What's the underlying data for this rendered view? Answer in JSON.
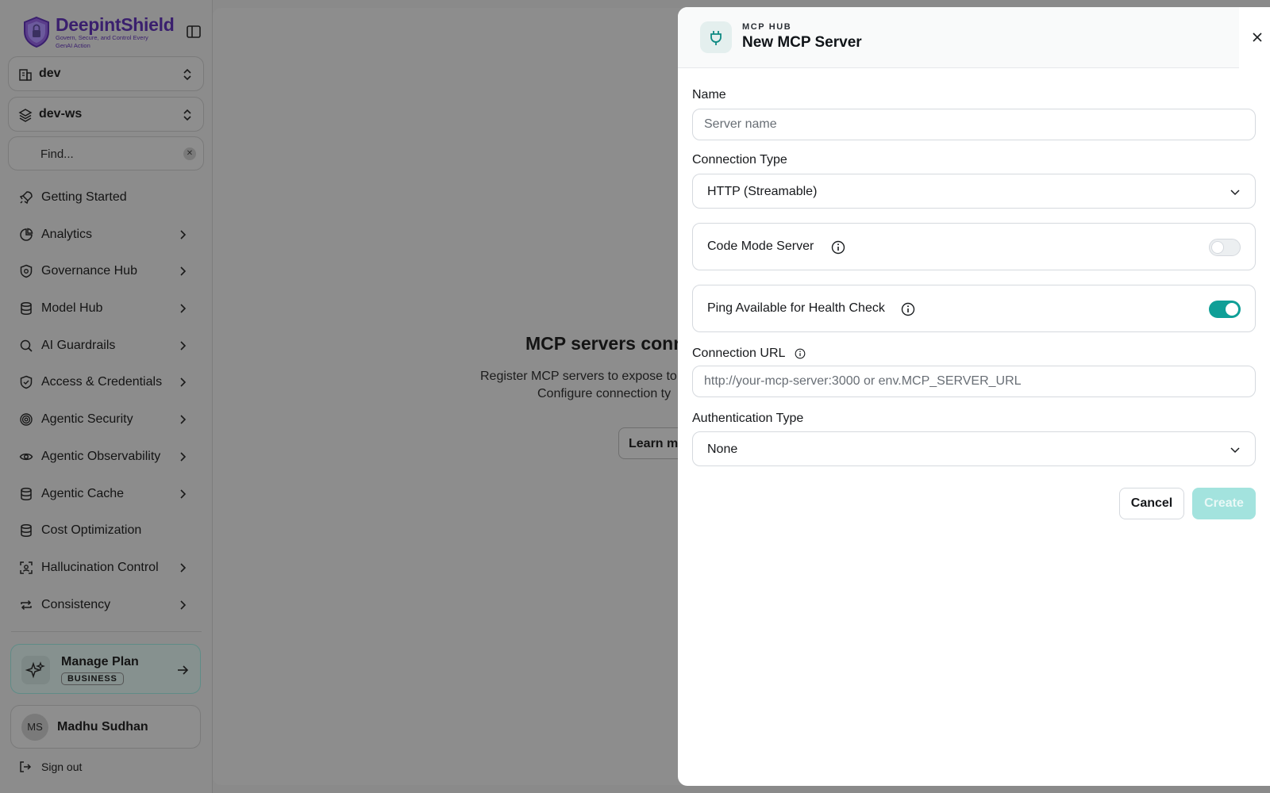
{
  "brand": {
    "name": "DeepintShield",
    "tagline": "Govern, Secure, and Control Every GenAI Action"
  },
  "selectors": {
    "org": "dev",
    "workspace": "dev-ws"
  },
  "find": {
    "label": "Find...",
    "clear": "✕"
  },
  "nav": {
    "items": [
      {
        "label": "Getting Started"
      },
      {
        "label": "Analytics"
      },
      {
        "label": "Governance Hub"
      },
      {
        "label": "Model Hub"
      },
      {
        "label": "AI Guardrails"
      },
      {
        "label": "Access & Credentials"
      },
      {
        "label": "Agentic Security"
      },
      {
        "label": "Agentic Observability"
      },
      {
        "label": "Agentic Cache"
      },
      {
        "label": "Cost Optimization"
      },
      {
        "label": "Hallucination Control"
      },
      {
        "label": "Consistency"
      }
    ]
  },
  "plan": {
    "title": "Manage Plan",
    "badge": "BUSINESS"
  },
  "user": {
    "initials": "MS",
    "name": "Madhu Sudhan"
  },
  "signout": {
    "label": "Sign out"
  },
  "empty_state": {
    "title": "MCP servers conne",
    "line1": "Register MCP servers to expose to",
    "line2": "Configure connection ty",
    "button": "Learn m"
  },
  "drawer": {
    "eyebrow": "MCP HUB",
    "title": "New MCP Server",
    "name_label": "Name",
    "name_placeholder": "Server name",
    "conn_type_label": "Connection Type",
    "conn_type_value": "HTTP (Streamable)",
    "code_mode_label": "Code Mode Server",
    "code_mode_on": false,
    "ping_label": "Ping Available for Health Check",
    "ping_on": true,
    "url_label": "Connection URL",
    "url_placeholder": "http://your-mcp-server:3000 or env.MCP_SERVER_URL",
    "auth_label": "Authentication Type",
    "auth_value": "None",
    "cancel": "Cancel",
    "create": "Create"
  },
  "colors": {
    "accent": "#0f9f97",
    "brand": "#3a1f6e",
    "create_disabled": "#a3e3de"
  }
}
